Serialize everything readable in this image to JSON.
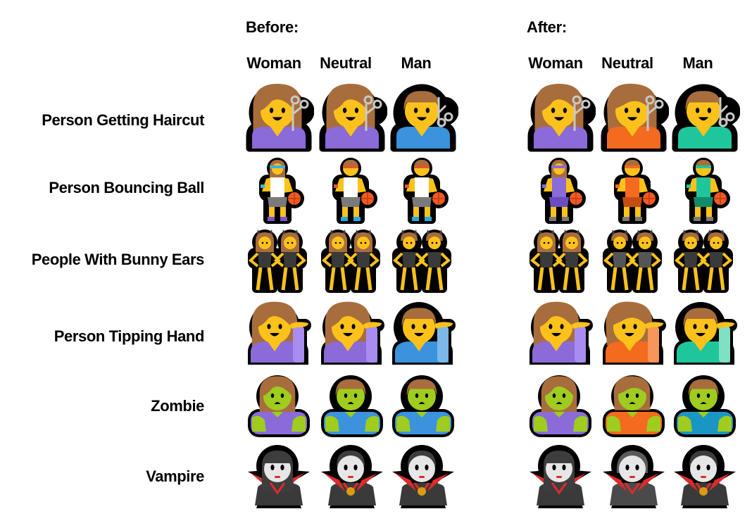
{
  "sections": [
    {
      "title": "Before:",
      "columns": [
        "Woman",
        "Neutral",
        "Man"
      ]
    },
    {
      "title": "After:",
      "columns": [
        "Woman",
        "Neutral",
        "Man"
      ]
    }
  ],
  "rows": [
    {
      "label": "Person Getting Haircut",
      "kind": "haircut",
      "before": [
        {
          "hair": "woman",
          "shirt": "#8a6bd8"
        },
        {
          "hair": "woman",
          "shirt": "#8a6bd8"
        },
        {
          "hair": "man",
          "shirt": "#3a93dc"
        }
      ],
      "after": [
        {
          "hair": "woman",
          "shirt": "#8a6bd8"
        },
        {
          "hair": "neutral",
          "shirt": "#f46a1e"
        },
        {
          "hair": "man",
          "shirt": "#1fc69b"
        }
      ]
    },
    {
      "label": "Person Bouncing Ball",
      "kind": "ball",
      "before": [
        {
          "hair": "woman",
          "shirt": "#ffffff",
          "shorts": "#7a7a7a",
          "band": "#3ab3e0",
          "shoes": "#7c54d4"
        },
        {
          "hair": "man",
          "shirt": "#ffffff",
          "shorts": "#7a7a7a",
          "band": "#e0552a",
          "shoes": "#27a9e1"
        },
        {
          "hair": "man",
          "shirt": "#ffffff",
          "shorts": "#7a7a7a",
          "band": "#e0552a",
          "shoes": "#27a9e1"
        }
      ],
      "after": [
        {
          "hair": "woman",
          "shirt": "#8a6bd8",
          "shorts": "#6a4cc0",
          "band": "#8a6bd8",
          "shoes": "#7a7a7a"
        },
        {
          "hair": "neutral",
          "shirt": "#f46a1e",
          "shorts": "#c44e12",
          "band": "#f46a1e",
          "shoes": "#7a7a7a"
        },
        {
          "hair": "man",
          "shirt": "#1fc69b",
          "shorts": "#138a6a",
          "band": "#1fc69b",
          "shoes": "#7a7a7a"
        }
      ]
    },
    {
      "label": "People With Bunny Ears",
      "kind": "bunny",
      "before": [
        {
          "hair": "woman",
          "suit": "#3a3a3a"
        },
        {
          "hair": "woman",
          "suit": "#3a3a3a"
        },
        {
          "hair": "man",
          "suit": "#3a3a3a"
        }
      ],
      "after": [
        {
          "hair": "woman",
          "suit": "#3a3a3a"
        },
        {
          "hair": "neutral",
          "suit": "#555555"
        },
        {
          "hair": "man",
          "suit": "#3a3a3a"
        }
      ]
    },
    {
      "label": "Person Tipping Hand",
      "kind": "tipping",
      "before": [
        {
          "hair": "woman",
          "shirt": "#8a6bd8",
          "arm": "#a98cf0"
        },
        {
          "hair": "woman",
          "shirt": "#8a6bd8",
          "arm": "#a98cf0"
        },
        {
          "hair": "man",
          "shirt": "#3a93dc",
          "arm": "#7cb8ea"
        }
      ],
      "after": [
        {
          "hair": "woman",
          "shirt": "#8a6bd8",
          "arm": "#a98cf0"
        },
        {
          "hair": "neutral",
          "shirt": "#f46a1e",
          "arm": "#f7955a"
        },
        {
          "hair": "man",
          "shirt": "#1fc69b",
          "arm": "#7fe0c4"
        }
      ]
    },
    {
      "label": "Zombie",
      "kind": "zombie",
      "before": [
        {
          "hair": "woman",
          "shirt": "#8a6bd8"
        },
        {
          "hair": "man",
          "shirt": "#3a93dc"
        },
        {
          "hair": "man",
          "shirt": "#3a93dc"
        }
      ],
      "after": [
        {
          "hair": "woman",
          "shirt": "#8a6bd8"
        },
        {
          "hair": "neutral",
          "shirt": "#f46a1e"
        },
        {
          "hair": "man",
          "shirt": "#1a96c4"
        }
      ]
    },
    {
      "label": "Vampire",
      "kind": "vampire",
      "before": [
        {
          "hair": "woman",
          "cape": "#3a3a3a",
          "medal": false
        },
        {
          "hair": "man",
          "cape": "#3a3a3a",
          "medal": true
        },
        {
          "hair": "man",
          "cape": "#3a3a3a",
          "medal": true
        }
      ],
      "after": [
        {
          "hair": "woman",
          "cape": "#3a3a3a",
          "medal": false
        },
        {
          "hair": "neutral",
          "cape": "#4a4a4a",
          "medal": false
        },
        {
          "hair": "man",
          "cape": "#3a3a3a",
          "medal": true
        }
      ]
    }
  ],
  "palette": {
    "skin": "#fcc21b",
    "hair": "#a86d3c",
    "outline": "#000000",
    "zombie_skin": "#9fcc1e",
    "vampire_skin": "#e6e6e6",
    "vampire_hair": "#3d3d3d",
    "cape_lining": "#e02a2a",
    "medal": "#d89b12",
    "ball": "#f15a24",
    "scissors": "#c8c8c8"
  }
}
